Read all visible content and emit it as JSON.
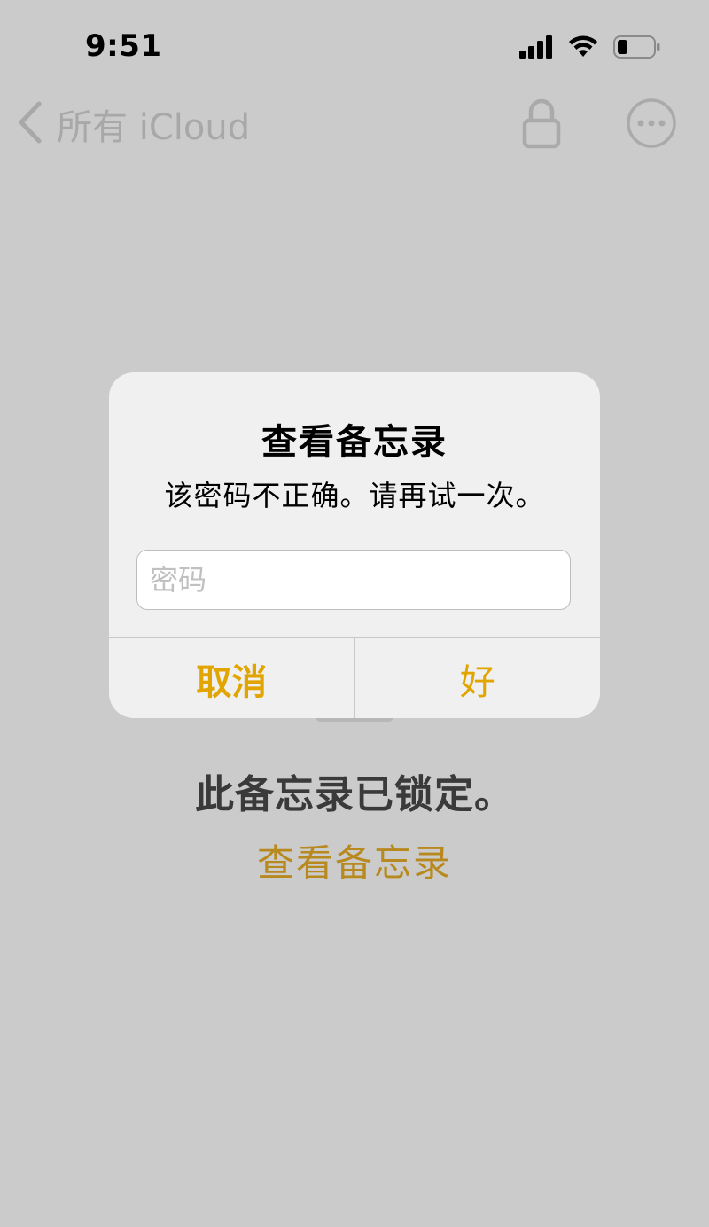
{
  "status_bar": {
    "time": "9:51",
    "signal_icon": "cellular-signal-icon",
    "wifi_icon": "wifi-icon",
    "battery_icon": "battery-icon"
  },
  "nav": {
    "back_label": "所有 iCloud",
    "back_icon": "chevron-left-icon",
    "lock_icon": "lock-icon",
    "more_icon": "ellipsis-circle-icon"
  },
  "content": {
    "locked_message": "此备忘录已锁定。",
    "view_note_link": "查看备忘录"
  },
  "alert": {
    "title": "查看备忘录",
    "message": "该密码不正确。请再试一次。",
    "password_placeholder": "密码",
    "password_value": "",
    "cancel_label": "取消",
    "ok_label": "好"
  },
  "colors": {
    "background": "#cbcbcb",
    "accent": "#e2a500",
    "link_dimmed": "#b8891e",
    "alert_bg": "#f0f0f0"
  }
}
